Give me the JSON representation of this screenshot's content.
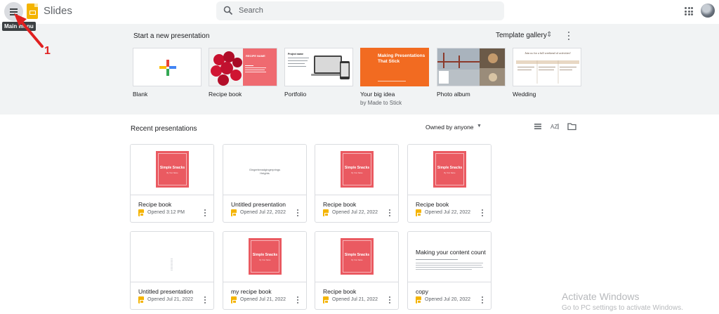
{
  "header": {
    "app_name": "Slides",
    "search_placeholder": "Search",
    "menu_tooltip": "Main menu",
    "annotation_number": "1"
  },
  "gallery": {
    "title": "Start a new presentation",
    "link": "Template gallery",
    "templates": [
      {
        "name": "Blank",
        "sub": ""
      },
      {
        "name": "Recipe book",
        "sub": "",
        "thumb_title": "RECIPE NAME"
      },
      {
        "name": "Portfolio",
        "sub": "",
        "thumb_title": "Project name"
      },
      {
        "name": "Your big idea",
        "sub": "by Made to Stick",
        "thumb_title": "Making Presentations That Stick"
      },
      {
        "name": "Photo album",
        "sub": ""
      },
      {
        "name": "Wedding",
        "sub": "",
        "thumb_title": "Join us for a full weekend of activities!"
      }
    ]
  },
  "recent": {
    "title": "Recent presentations",
    "owner_filter": "Owned by anyone",
    "files": [
      {
        "title": "Recipe book",
        "date": "Opened 3:12 PM",
        "thumb": "snack"
      },
      {
        "title": "Untitled presentation",
        "date": "Opened Jul 22, 2022",
        "thumb": "text",
        "thumb_text": "Gingerbreadgingerprings Heights"
      },
      {
        "title": "Recipe book",
        "date": "Opened Jul 22, 2022",
        "thumb": "snack"
      },
      {
        "title": "Recipe book",
        "date": "Opened Jul 22, 2022",
        "thumb": "snack"
      },
      {
        "title": "Untitled presentation",
        "date": "Opened Jul 21, 2022",
        "thumb": "blank"
      },
      {
        "title": "my recipe book",
        "date": "Opened Jul 21, 2022",
        "thumb": "snack"
      },
      {
        "title": "Recipe book",
        "date": "Opened Jul 21, 2022",
        "thumb": "snack"
      },
      {
        "title": "copy",
        "date": "Opened Jul 20, 2022",
        "thumb": "content",
        "thumb_text": "Making your content count"
      }
    ],
    "snack_title": "Simple Snacks",
    "snack_sub": "By Your Name"
  },
  "watermark": {
    "line1": "Activate Windows",
    "line2": "Go to PC settings to activate Windows."
  }
}
